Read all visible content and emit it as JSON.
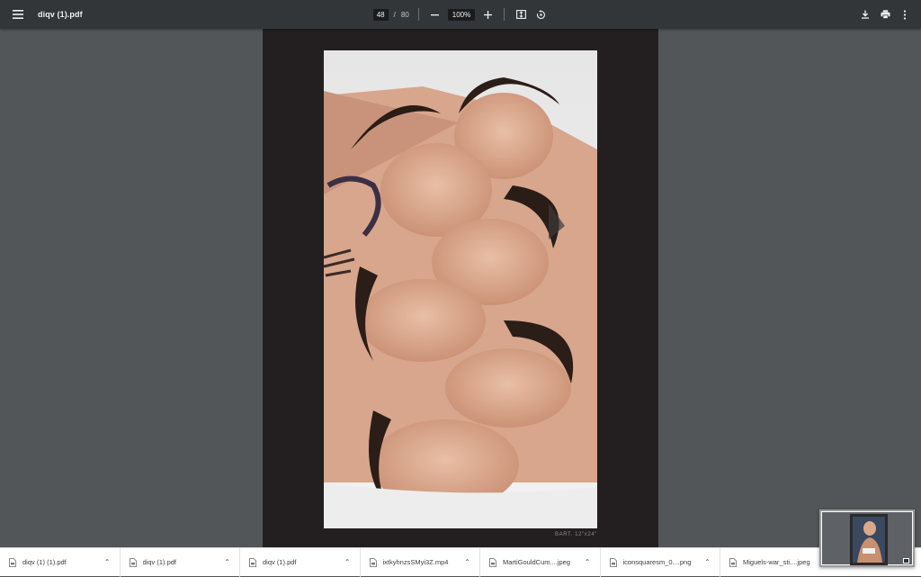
{
  "toolbar": {
    "title": "diqv (1).pdf",
    "page_current": "48",
    "page_separator": "/",
    "page_total": "80",
    "zoom_value": "100%",
    "zoom_out_icon": "minus-icon",
    "zoom_in_icon": "plus-icon",
    "fit_icon": "fit-page-icon",
    "rotate_icon": "rotate-icon",
    "download_icon": "download-icon",
    "print_icon": "print-icon",
    "more_icon": "more-vert-icon"
  },
  "document": {
    "caption": "BART. 12\"x24\""
  },
  "downloads": [
    {
      "name": "diqv (1) (1).pdf",
      "icon": "file-icon"
    },
    {
      "name": "diqv (1).pdf",
      "icon": "file-icon"
    },
    {
      "name": "diqv (1).pdf",
      "icon": "file-icon"
    },
    {
      "name": "ixtkyhnzsSMyi3Z.mp4",
      "icon": "file-icon"
    },
    {
      "name": "MartiGouldCum....jpeg",
      "icon": "file-icon"
    },
    {
      "name": "iconsquaresm_0....png",
      "icon": "file-icon"
    },
    {
      "name": "Miguels-war_sti....jpeg",
      "icon": "file-icon"
    }
  ],
  "colors": {
    "toolbar_bg": "#323639",
    "viewer_bg": "#525659",
    "page_bg": "#231f20"
  }
}
